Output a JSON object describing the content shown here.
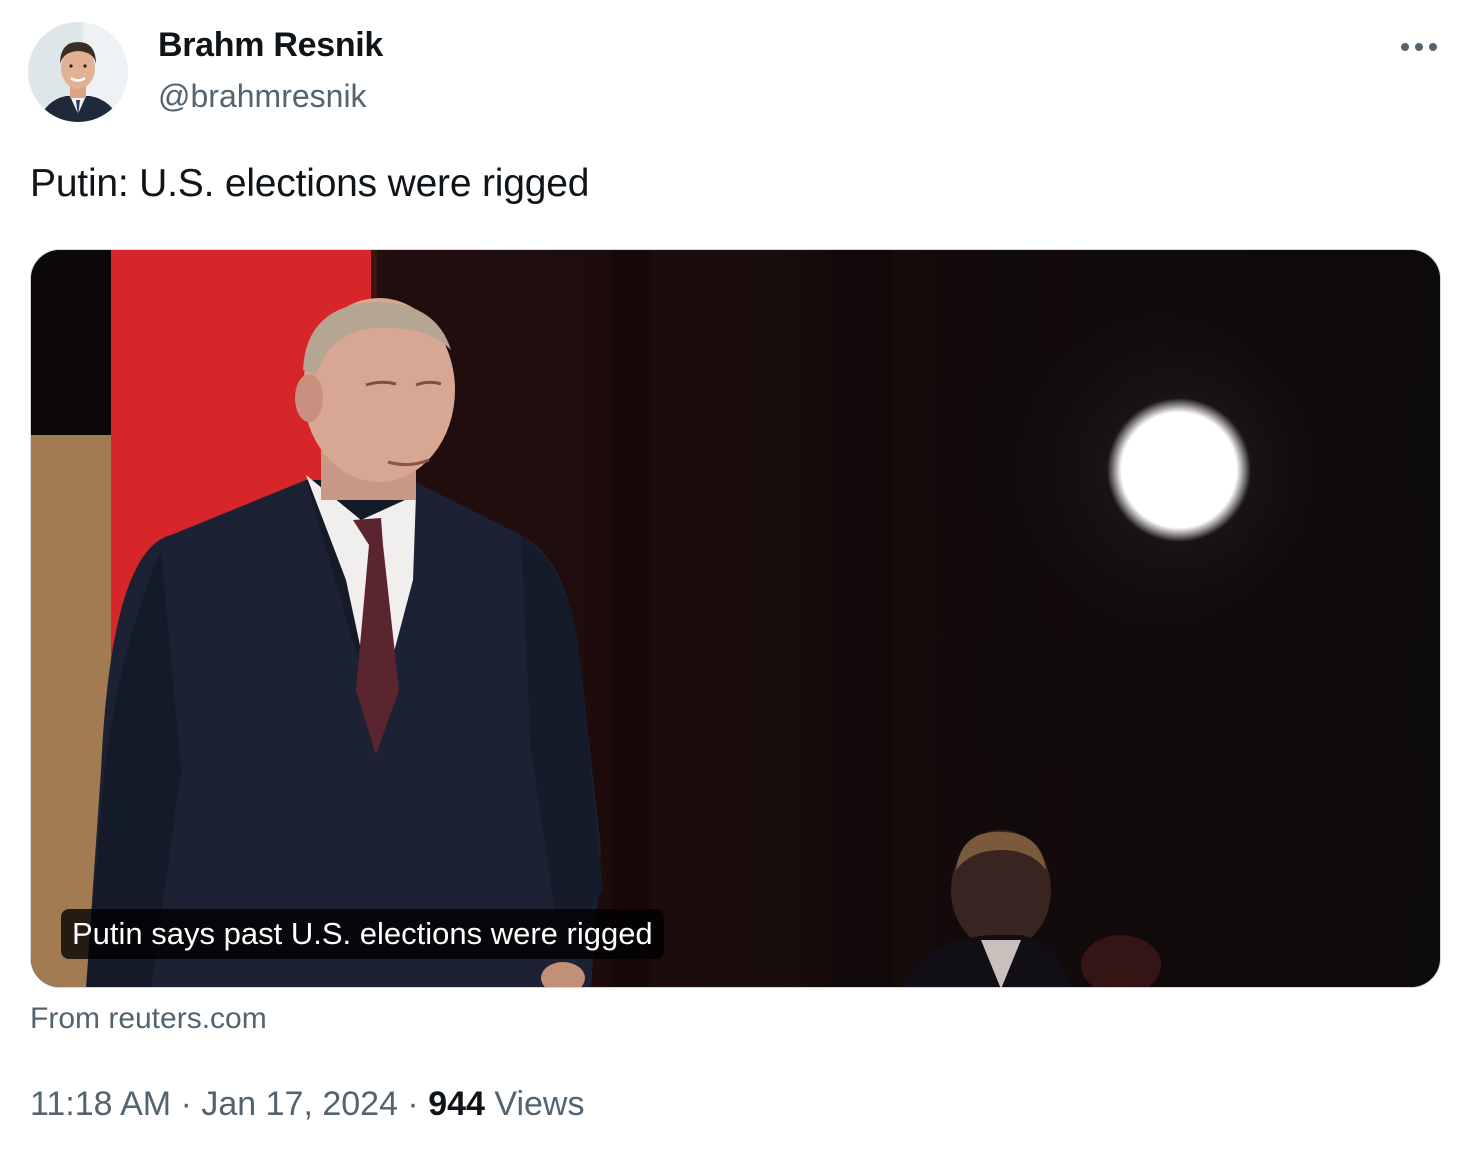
{
  "author": {
    "name": "Brahm Resnik",
    "handle": "@brahmresnik"
  },
  "tweet": {
    "text": "Putin: U.S. elections were rigged"
  },
  "card": {
    "caption": "Putin says past U.S. elections were rigged",
    "source": "From reuters.com"
  },
  "meta": {
    "time": "11:18 AM",
    "sep1": " · ",
    "date": "Jan 17, 2024",
    "sep2": " · ",
    "views_count": "944",
    "views_label": " Views"
  },
  "icons": {
    "more": "more-horizontal-icon"
  },
  "colors": {
    "text_primary": "#0f1419",
    "text_secondary": "#536471",
    "border": "#cfd9de"
  }
}
